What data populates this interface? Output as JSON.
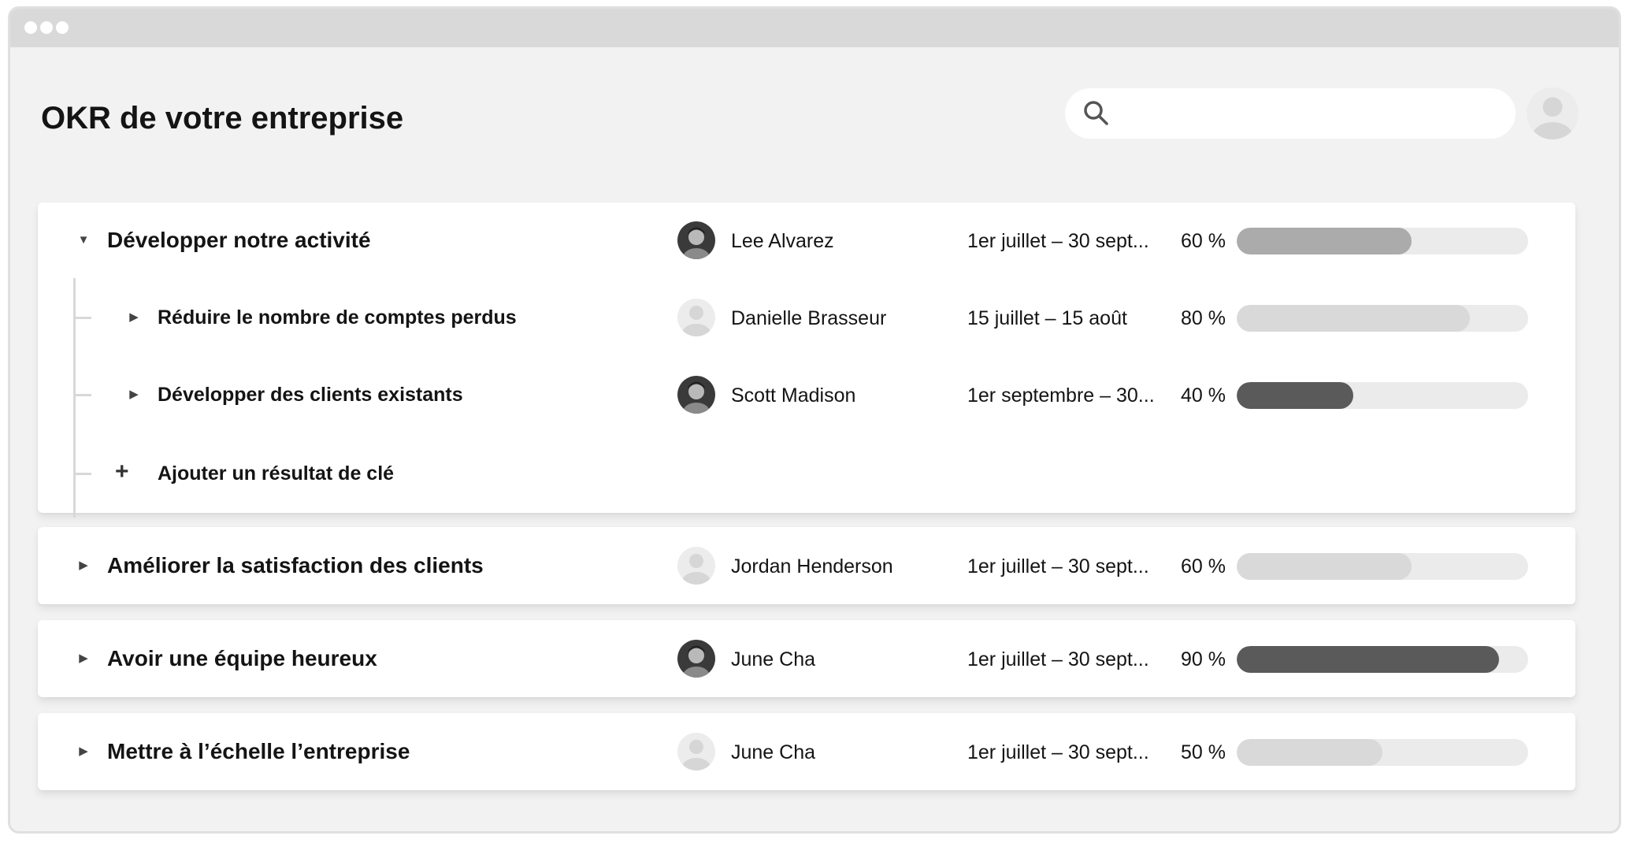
{
  "app": {
    "title": "OKR de votre entreprise"
  },
  "search": {
    "placeholder": ""
  },
  "colors": {
    "accent_dark": "#5a5a5a",
    "accent_mid": "#ababab",
    "accent_light": "#d9d9d9",
    "track": "#ebebeb"
  },
  "objectives": [
    {
      "title": "Développer notre activité",
      "expanded": true,
      "owner": "Lee Alvarez",
      "dates": "1er juillet – 30 sept...",
      "progress_label": "60 %",
      "progress": 0.6,
      "avatar": "photo",
      "key_results": [
        {
          "title": "Réduire le nombre de comptes perdus",
          "owner": "Danielle Brasseur",
          "dates": "15 juillet – 15 août",
          "progress_label": "80 %",
          "progress": 0.8,
          "avatar": "placeholder"
        },
        {
          "title": "Développer des clients existants",
          "owner": "Scott Madison",
          "dates": "1er septembre – 30...",
          "progress_label": "40 %",
          "progress": 0.4,
          "avatar": "photo"
        }
      ],
      "add_key_result_label": "Ajouter un résultat de clé"
    },
    {
      "title": "Améliorer la satisfaction des clients",
      "expanded": false,
      "owner": "Jordan Henderson",
      "dates": "1er juillet – 30 sept...",
      "progress_label": "60 %",
      "progress": 0.6,
      "avatar": "placeholder"
    },
    {
      "title": "Avoir une équipe heureux",
      "expanded": false,
      "owner": "June Cha",
      "dates": "1er juillet – 30 sept...",
      "progress_label": "90 %",
      "progress": 0.9,
      "avatar": "photo"
    },
    {
      "title": "Mettre à l’échelle l’entreprise",
      "expanded": false,
      "owner": "June Cha",
      "dates": "1er juillet – 30 sept...",
      "progress_label": "50 %",
      "progress": 0.5,
      "avatar": "placeholder"
    }
  ]
}
